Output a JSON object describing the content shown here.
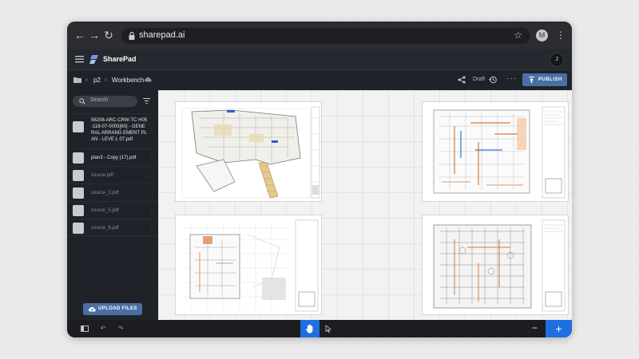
{
  "browser": {
    "url": "sharepad.ai",
    "profile_initial": "M"
  },
  "app": {
    "name": "SharePad",
    "user_initial": "J",
    "accent": "#1f6fe0",
    "button_color": "#4a6fa5"
  },
  "breadcrumb": {
    "items": [
      "p2",
      "Workbench"
    ]
  },
  "toolbar": {
    "status": "Draft",
    "publish_label": "PUBLISH"
  },
  "sidebar": {
    "search_placeholder": "Search",
    "upload_label": "UPLOAD FILES",
    "files": [
      {
        "name": "56208-ARC-CRW-TC H05-118-07-0005[60] - GENERAL ARRANG EMENT PLAN - LEVE L 07.pdf",
        "active": true
      },
      {
        "name": "plan3 - Copy (17).pdf",
        "active": true
      },
      {
        "name": "source.pdf",
        "active": false
      },
      {
        "name": "source_2.pdf",
        "active": false
      },
      {
        "name": "source_5.pdf",
        "active": false
      },
      {
        "name": "source_6.pdf",
        "active": false
      }
    ]
  },
  "icons": {
    "back": "arrow-left-icon",
    "forward": "arrow-right-icon",
    "reload": "reload-icon",
    "hand": "hand-tool-icon",
    "pointer": "pointer-tool-icon",
    "zoom_out": "zoom-out-icon",
    "zoom_in": "zoom-in-icon"
  }
}
